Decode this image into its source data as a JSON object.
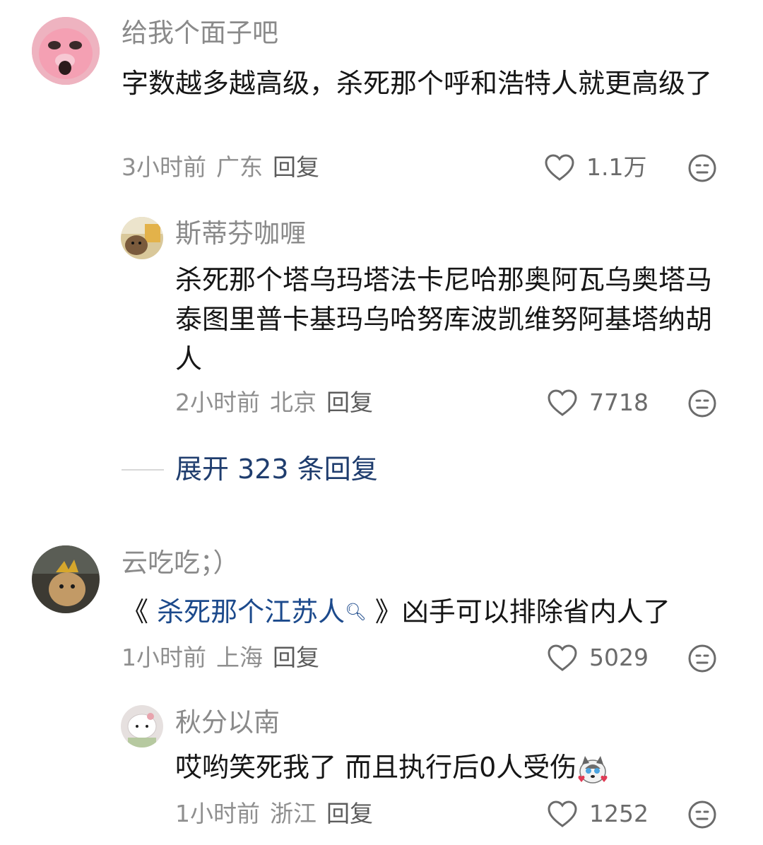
{
  "comments": [
    {
      "username": "给我个面子吧",
      "content": "字数越多越高级，杀死那个呼和浩特人就更高级了",
      "time": "3小时前",
      "location": "广东",
      "reply_label": "回复",
      "likes": "1.1万",
      "avatar_icon": "pink-pig-avatar",
      "replies": [
        {
          "username": "斯蒂芬咖喱",
          "content": "杀死那个塔乌玛塔法卡尼哈那奥阿瓦乌奥塔马泰图里普卡基玛乌哈努库波凯维努阿基塔纳胡人",
          "time": "2小时前",
          "location": "北京",
          "reply_label": "回复",
          "likes": "7718",
          "avatar_icon": "cat-photo-avatar"
        }
      ],
      "expand_label": "展开 323 条回复"
    },
    {
      "username": "云吃吃；）",
      "content_quote_open": "《",
      "content_link": "杀死那个江苏人",
      "content_quote_close": "》",
      "content_rest": "凶手可以排除省内人了",
      "time": "1小时前",
      "location": "上海",
      "reply_label": "回复",
      "likes": "5029",
      "avatar_icon": "cat-with-leaf-avatar",
      "replies": [
        {
          "username": "秋分以南",
          "content": "哎哟笑死我了 而且执行后0人受伤",
          "emoji": "husky-hearts-emoji",
          "time": "1小时前",
          "location": "浙江",
          "reply_label": "回复",
          "likes": "1252",
          "avatar_icon": "hello-kitty-avatar"
        }
      ]
    }
  ],
  "icons": {
    "like": "heart-outline-icon",
    "dislike": "meh-face-icon",
    "search": "search-icon"
  },
  "colors": {
    "link": "#1c4a8c",
    "expand": "#1f3d6e",
    "meta": "#8f8f8f"
  }
}
